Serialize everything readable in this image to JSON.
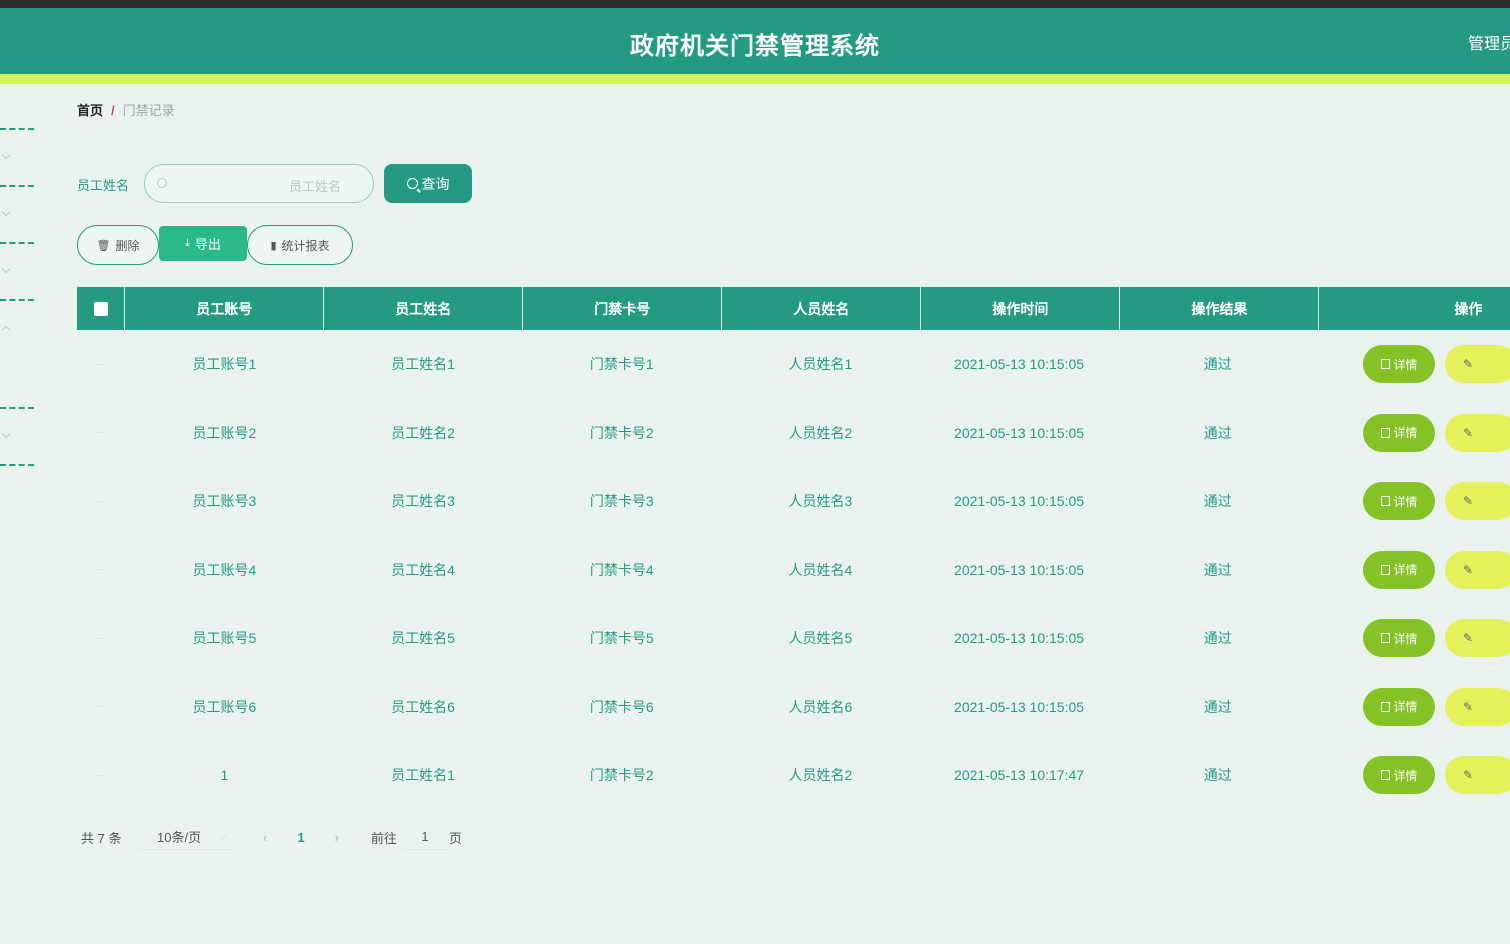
{
  "header": {
    "title": "政府机关门禁管理系统",
    "user_label": "管理员"
  },
  "breadcrumb": {
    "home": "首页",
    "separator": "/",
    "current": "门禁记录"
  },
  "search": {
    "label": "员工姓名",
    "placeholder": "员工姓名",
    "value": "",
    "query_button": "查询"
  },
  "toolbar": {
    "delete_label": "删除",
    "export_label": "导出",
    "report_label": "统计报表"
  },
  "table": {
    "columns": [
      "员工账号",
      "员工姓名",
      "门禁卡号",
      "人员姓名",
      "操作时间",
      "操作结果",
      "操作"
    ],
    "rows": [
      {
        "account": "员工账号1",
        "name": "员工姓名1",
        "card": "门禁卡号1",
        "person": "人员姓名1",
        "time": "2021-05-13 10:15:05",
        "result": "通过"
      },
      {
        "account": "员工账号2",
        "name": "员工姓名2",
        "card": "门禁卡号2",
        "person": "人员姓名2",
        "time": "2021-05-13 10:15:05",
        "result": "通过"
      },
      {
        "account": "员工账号3",
        "name": "员工姓名3",
        "card": "门禁卡号3",
        "person": "人员姓名3",
        "time": "2021-05-13 10:15:05",
        "result": "通过"
      },
      {
        "account": "员工账号4",
        "name": "员工姓名4",
        "card": "门禁卡号4",
        "person": "人员姓名4",
        "time": "2021-05-13 10:15:05",
        "result": "通过"
      },
      {
        "account": "员工账号5",
        "name": "员工姓名5",
        "card": "门禁卡号5",
        "person": "人员姓名5",
        "time": "2021-05-13 10:15:05",
        "result": "通过"
      },
      {
        "account": "员工账号6",
        "name": "员工姓名6",
        "card": "门禁卡号6",
        "person": "人员姓名6",
        "time": "2021-05-13 10:15:05",
        "result": "通过"
      },
      {
        "account": "1",
        "name": "员工姓名1",
        "card": "门禁卡号2",
        "person": "人员姓名2",
        "time": "2021-05-13 10:17:47",
        "result": "通过"
      }
    ],
    "detail_label": "详情",
    "edit_icon": "✎"
  },
  "pagination": {
    "total": "共 7 条",
    "page_size": "10条/页",
    "prev": "‹",
    "current_page": "1",
    "next": "›",
    "goto_label": "前往",
    "goto_value": "1",
    "page_suffix": "页"
  },
  "colors": {
    "primary": "#249a83",
    "accent": "#d4f05a",
    "detail_button": "#84c226",
    "edit_button": "#e3f25a",
    "background": "#eaf2ee"
  },
  "icons": {
    "search": "search-icon",
    "delete": "trash-icon",
    "export": "download-icon",
    "report": "bar-chart-icon",
    "detail": "document-icon",
    "edit": "pencil-icon"
  }
}
